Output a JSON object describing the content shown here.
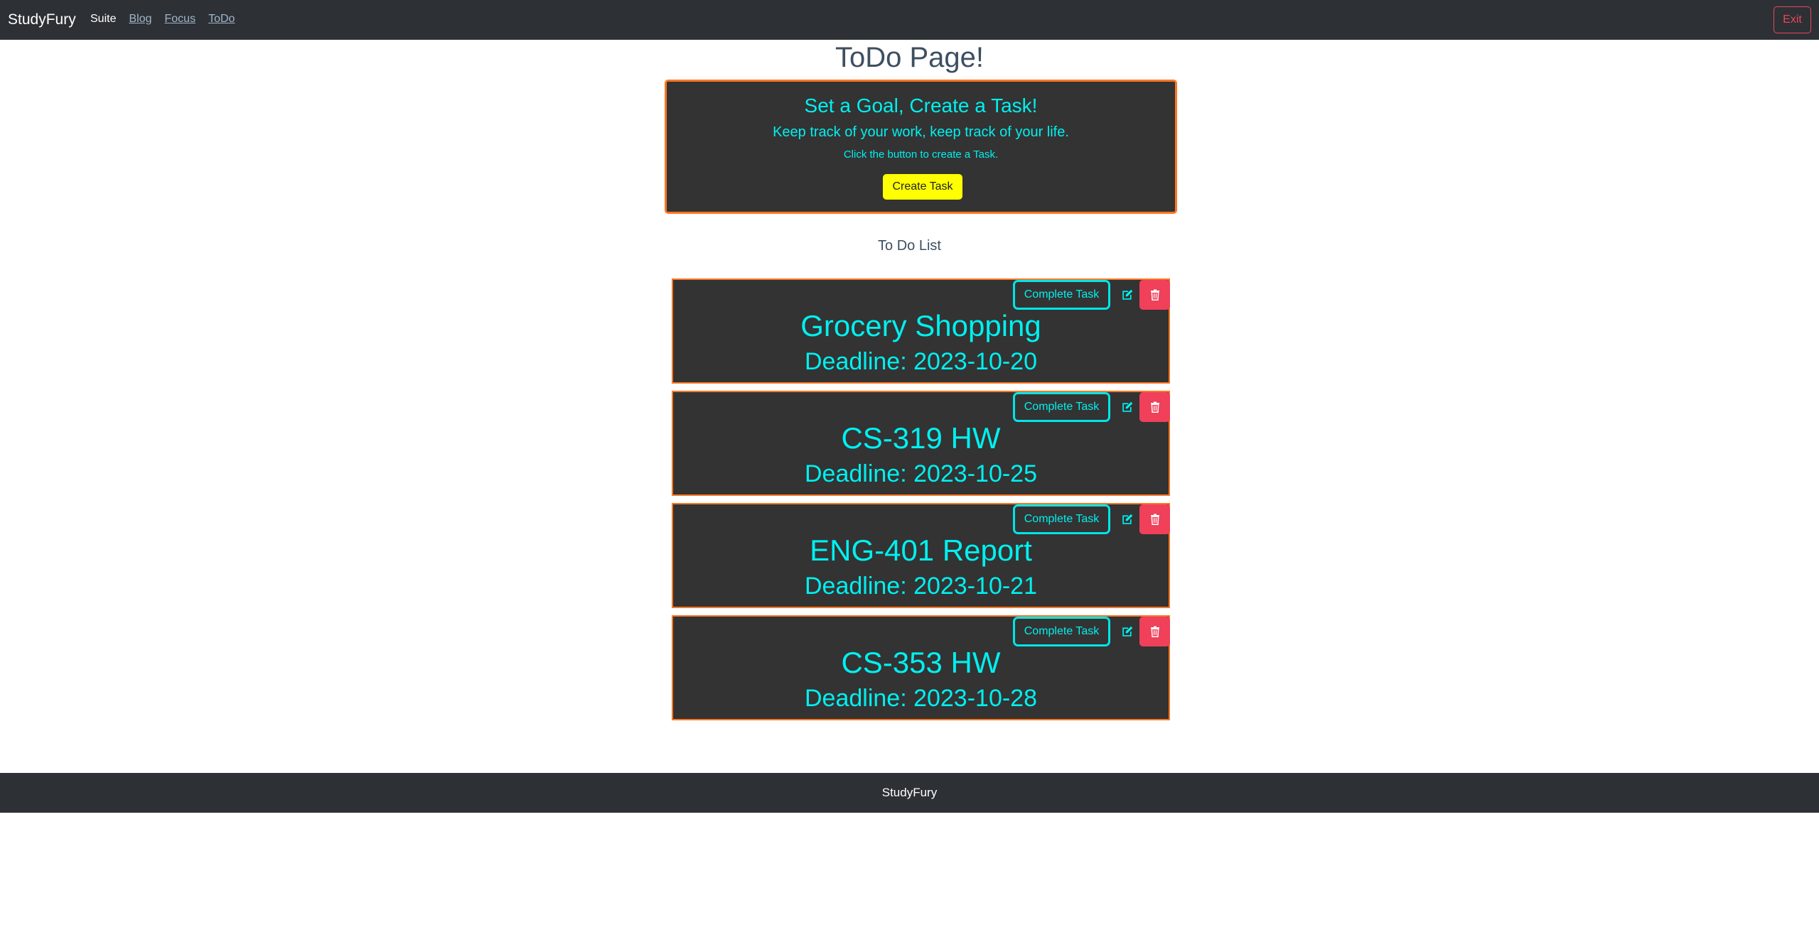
{
  "navbar": {
    "brand": "StudyFury",
    "links": [
      {
        "label": "Suite"
      },
      {
        "label": "Blog"
      },
      {
        "label": "Focus"
      },
      {
        "label": "ToDo"
      }
    ],
    "exit_label": "Exit"
  },
  "page": {
    "title": "ToDo Page!"
  },
  "hero": {
    "title": "Set a Goal, Create a Task!",
    "subtitle": "Keep track of your work, keep track of your life.",
    "hint": "Click the button to create a Task.",
    "button_label": "Create Task"
  },
  "list": {
    "header": "To Do List",
    "tasks": [
      {
        "title": "Grocery Shopping",
        "deadline": "Deadline: 2023-10-20",
        "complete_label": "Complete Task"
      },
      {
        "title": "CS-319 HW",
        "deadline": "Deadline: 2023-10-25",
        "complete_label": "Complete Task"
      },
      {
        "title": "ENG-401 Report",
        "deadline": "Deadline: 2023-10-21",
        "complete_label": "Complete Task"
      },
      {
        "title": "CS-353 HW",
        "deadline": "Deadline: 2023-10-28",
        "complete_label": "Complete Task"
      }
    ],
    "icons": {
      "edit": "edit-icon",
      "delete": "trash-icon"
    }
  },
  "footer": {
    "text": "StudyFury"
  },
  "colors": {
    "navbar_bg": "#2d3135",
    "card_bg": "#333333",
    "accent_cyan": "#00f0f0",
    "border_orange": "#ff7722",
    "danger": "#f0405a",
    "create_button": "#ffff00"
  }
}
